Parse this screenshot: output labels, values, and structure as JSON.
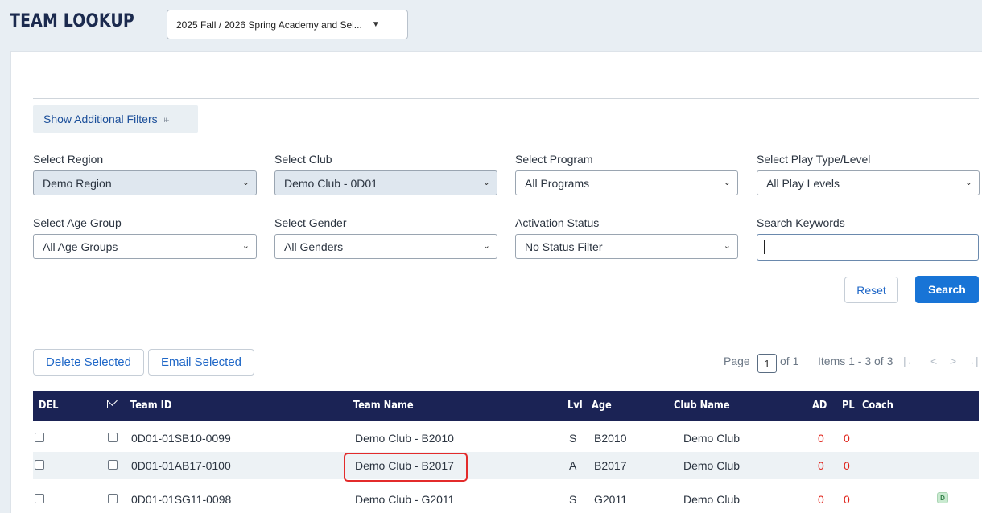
{
  "header": {
    "title": "TEAM LOOKUP",
    "season": "2025 Fall / 2026 Spring Academy and Sel..."
  },
  "filters": {
    "toggle_label": "Show Additional Filters",
    "region": {
      "label": "Select Region",
      "value": "Demo Region"
    },
    "club": {
      "label": "Select Club",
      "value": "Demo Club - 0D01"
    },
    "program": {
      "label": "Select Program",
      "value": "All Programs"
    },
    "play_type": {
      "label": "Select Play Type/Level",
      "value": "All Play Levels"
    },
    "age_group": {
      "label": "Select Age Group",
      "value": "All Age Groups"
    },
    "gender": {
      "label": "Select Gender",
      "value": "All Genders"
    },
    "activation": {
      "label": "Activation Status",
      "value": "No Status Filter"
    },
    "keywords": {
      "label": "Search Keywords",
      "value": ""
    },
    "reset_label": "Reset",
    "search_label": "Search"
  },
  "actions": {
    "delete_label": "Delete Selected",
    "email_label": "Email Selected"
  },
  "pager": {
    "page_label": "Page",
    "page": "1",
    "of_label": "of 1",
    "items_label": "Items 1 - 3 of 3",
    "first": "|←",
    "prev": "<",
    "next": ">",
    "last": "→|"
  },
  "table": {
    "headers": {
      "del": "DEL",
      "team_id": "Team ID",
      "team_name": "Team Name",
      "lvl": "Lvl",
      "age": "Age",
      "club_name": "Club Name",
      "ad": "AD",
      "pl": "PL",
      "coach": "Coach"
    },
    "rows": [
      {
        "team_id": "0D01-01SB10-0099",
        "team_name": "Demo Club - B2010",
        "lvl": "S",
        "age": "B2010",
        "club_name": "Demo Club",
        "ad": "0",
        "pl": "0",
        "badge": ""
      },
      {
        "team_id": "0D01-01AB17-0100",
        "team_name": "Demo Club - B2017",
        "lvl": "A",
        "age": "B2017",
        "club_name": "Demo Club",
        "ad": "0",
        "pl": "0",
        "badge": ""
      },
      {
        "team_id": "0D01-01SG11-0098",
        "team_name": "Demo Club - G2011",
        "lvl": "S",
        "age": "G2011",
        "club_name": "Demo Club",
        "ad": "0",
        "pl": "0",
        "badge": "D"
      }
    ]
  },
  "colors": {
    "header_bg": "#1b2355",
    "primary": "#1874d6",
    "highlight": "#e32b2b",
    "zero_count": "#e0241b"
  }
}
